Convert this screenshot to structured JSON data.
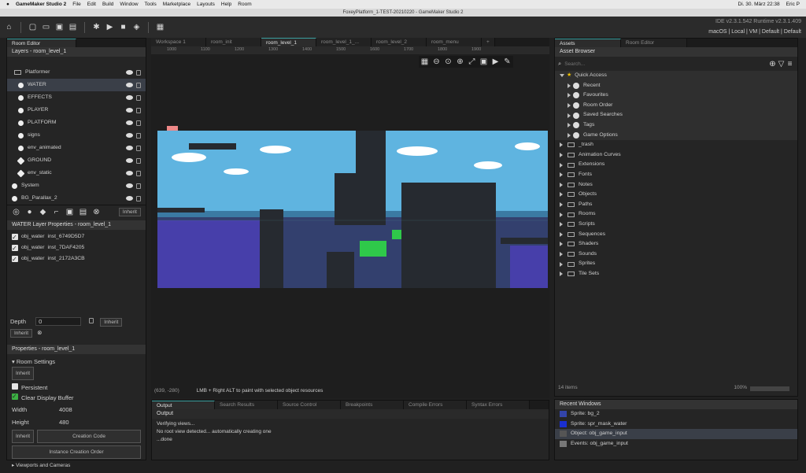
{
  "macbar": {
    "app": "GameMaker Studio 2",
    "menus": [
      "File",
      "Edit",
      "Build",
      "Window",
      "Tools",
      "Marketplace",
      "Layouts",
      "Help",
      "Room"
    ],
    "clock": "Di. 30. März  22:38",
    "user": "Eric P"
  },
  "window_title": "FoxeyPlatform_1-TEST-20210220 - GameMaker Studio 2",
  "ide": {
    "version": "IDE v2.3.1.542  Runtime v2.3.1.409",
    "target": "macOS | Local | VM | Default | Default"
  },
  "room_editor": {
    "tab": "Room Editor",
    "layers_header": "Layers - room_level_1",
    "layers": [
      {
        "name": "Platformer",
        "type": "folder"
      },
      {
        "name": "WATER",
        "type": "instance",
        "selected": true
      },
      {
        "name": "EFFECTS",
        "type": "instance"
      },
      {
        "name": "PLAYER",
        "type": "instance"
      },
      {
        "name": "PLATFORM",
        "type": "instance"
      },
      {
        "name": "signs",
        "type": "instance"
      },
      {
        "name": "env_animated",
        "type": "instance"
      },
      {
        "name": "GROUND",
        "type": "tile"
      },
      {
        "name": "env_static",
        "type": "tile"
      },
      {
        "name": "System",
        "type": "instance"
      },
      {
        "name": "BG_Parallax_2",
        "type": "bg"
      }
    ],
    "inherit": "Inherit",
    "layer_props_header": "WATER Layer Properties - room_level_1",
    "instances": [
      {
        "obj": "obj_water",
        "inst": "inst_6749D5D7"
      },
      {
        "obj": "obj_water",
        "inst": "inst_7DAF4205"
      },
      {
        "obj": "obj_water",
        "inst": "inst_2172A3CB"
      }
    ],
    "depth_label": "Depth",
    "depth_value": "0"
  },
  "properties": {
    "header": "Properties - room_level_1",
    "room_settings": "Room Settings",
    "inherit": "Inherit",
    "persistent": "Persistent",
    "clear_display": "Clear Display Buffer",
    "width_label": "Width",
    "width": "4008",
    "height_label": "Height",
    "height": "480",
    "creation_code": "Creation Code",
    "instance_order": "Instance Creation Order",
    "viewports": "Viewports and Cameras"
  },
  "workspace_tabs": [
    "Workspace 1",
    "room_init",
    "room_level_1",
    "room_level_1_...",
    "room_level_2",
    "room_menu"
  ],
  "ruler": [
    "1000",
    "1100",
    "1200",
    "1300",
    "1400",
    "1500",
    "1600",
    "1700",
    "1800",
    "1900"
  ],
  "status": {
    "coords": "(639, -280)",
    "hint": "LMB + Right ALT to paint with selected object resources"
  },
  "output": {
    "tabs": [
      "Output",
      "Search Results",
      "Source Control",
      "Breakpoints",
      "Compile Errors",
      "Syntax Errors"
    ],
    "title": "Output",
    "lines": [
      "Verifying views...",
      "No root view detected... automatically creating one",
      "...done"
    ]
  },
  "assets": {
    "tabs": [
      "Assets",
      "Room Editor"
    ],
    "header": "Asset Browser",
    "search_placeholder": "Search...",
    "quick_access": "Quick Access",
    "quick_items": [
      "Recent",
      "Favourites",
      "Room Order",
      "Saved Searches",
      "Tags",
      "Game Options"
    ],
    "folders": [
      "_trash",
      "Animation Curves",
      "Extensions",
      "Fonts",
      "Notes",
      "Objects",
      "Paths",
      "Rooms",
      "Scripts",
      "Sequences",
      "Shaders",
      "Sounds",
      "Sprites",
      "Tile Sets"
    ],
    "count": "14 items",
    "zoom": "100%"
  },
  "recent": {
    "header": "Recent Windows",
    "items": [
      "Sprite: bg_2",
      "Sprite: spr_mask_water",
      "Object: obj_game_input",
      "Events: obj_game_input"
    ]
  }
}
